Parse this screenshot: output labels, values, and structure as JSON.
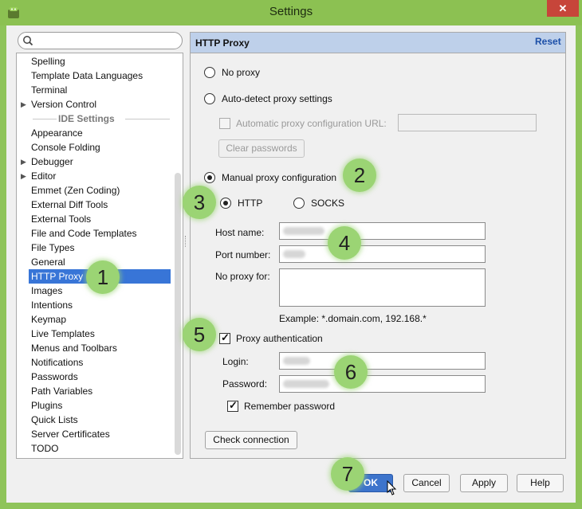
{
  "window": {
    "title": "Settings",
    "close_label": "✕"
  },
  "sidebar": {
    "search_placeholder": "",
    "items": [
      {
        "label": "Spelling",
        "arrow": false,
        "selected": false
      },
      {
        "label": "Template Data Languages",
        "arrow": false,
        "selected": false
      },
      {
        "label": "Terminal",
        "arrow": false,
        "selected": false
      },
      {
        "label": "Version Control",
        "arrow": true,
        "selected": false
      },
      {
        "label": "IDE Settings",
        "separator": true
      },
      {
        "label": "Appearance",
        "arrow": false,
        "selected": false
      },
      {
        "label": "Console Folding",
        "arrow": false,
        "selected": false
      },
      {
        "label": "Debugger",
        "arrow": true,
        "selected": false
      },
      {
        "label": "Editor",
        "arrow": true,
        "selected": false
      },
      {
        "label": "Emmet (Zen Coding)",
        "arrow": false,
        "selected": false
      },
      {
        "label": "External Diff Tools",
        "arrow": false,
        "selected": false
      },
      {
        "label": "External Tools",
        "arrow": false,
        "selected": false
      },
      {
        "label": "File and Code Templates",
        "arrow": false,
        "selected": false
      },
      {
        "label": "File Types",
        "arrow": false,
        "selected": false
      },
      {
        "label": "General",
        "arrow": false,
        "selected": false
      },
      {
        "label": "HTTP Proxy",
        "arrow": false,
        "selected": true
      },
      {
        "label": "Images",
        "arrow": false,
        "selected": false
      },
      {
        "label": "Intentions",
        "arrow": false,
        "selected": false
      },
      {
        "label": "Keymap",
        "arrow": false,
        "selected": false
      },
      {
        "label": "Live Templates",
        "arrow": false,
        "selected": false
      },
      {
        "label": "Menus and Toolbars",
        "arrow": false,
        "selected": false
      },
      {
        "label": "Notifications",
        "arrow": false,
        "selected": false
      },
      {
        "label": "Passwords",
        "arrow": false,
        "selected": false
      },
      {
        "label": "Path Variables",
        "arrow": false,
        "selected": false
      },
      {
        "label": "Plugins",
        "arrow": false,
        "selected": false
      },
      {
        "label": "Quick Lists",
        "arrow": false,
        "selected": false
      },
      {
        "label": "Server Certificates",
        "arrow": false,
        "selected": false
      },
      {
        "label": "TODO",
        "arrow": false,
        "selected": false
      }
    ]
  },
  "panel": {
    "title": "HTTP Proxy",
    "reset_label": "Reset",
    "no_proxy_label": "No proxy",
    "auto_detect_label": "Auto-detect proxy settings",
    "auto_config_url_label": "Automatic proxy configuration URL:",
    "clear_passwords_label": "Clear passwords",
    "manual_label": "Manual proxy configuration",
    "http_label": "HTTP",
    "socks_label": "SOCKS",
    "host_label": "Host name:",
    "port_label": "Port number:",
    "no_proxy_for_label": "No proxy for:",
    "example_text": "Example: *.domain.com, 192.168.*",
    "proxy_auth_label": "Proxy authentication",
    "login_label": "Login:",
    "password_label": "Password:",
    "remember_label": "Remember password",
    "check_connection_label": "Check connection",
    "selected_mode": "manual",
    "selected_protocol": "HTTP",
    "proxy_auth_checked": true,
    "remember_checked": true
  },
  "footer": {
    "ok_label": "OK",
    "cancel_label": "Cancel",
    "apply_label": "Apply",
    "help_label": "Help"
  },
  "annotations": [
    "1",
    "2",
    "3",
    "4",
    "5",
    "6",
    "7"
  ],
  "colors": {
    "title_bar": "#8cc152",
    "selection": "#3875d7",
    "badge": "#9bd474",
    "header": "#bed0ea"
  }
}
